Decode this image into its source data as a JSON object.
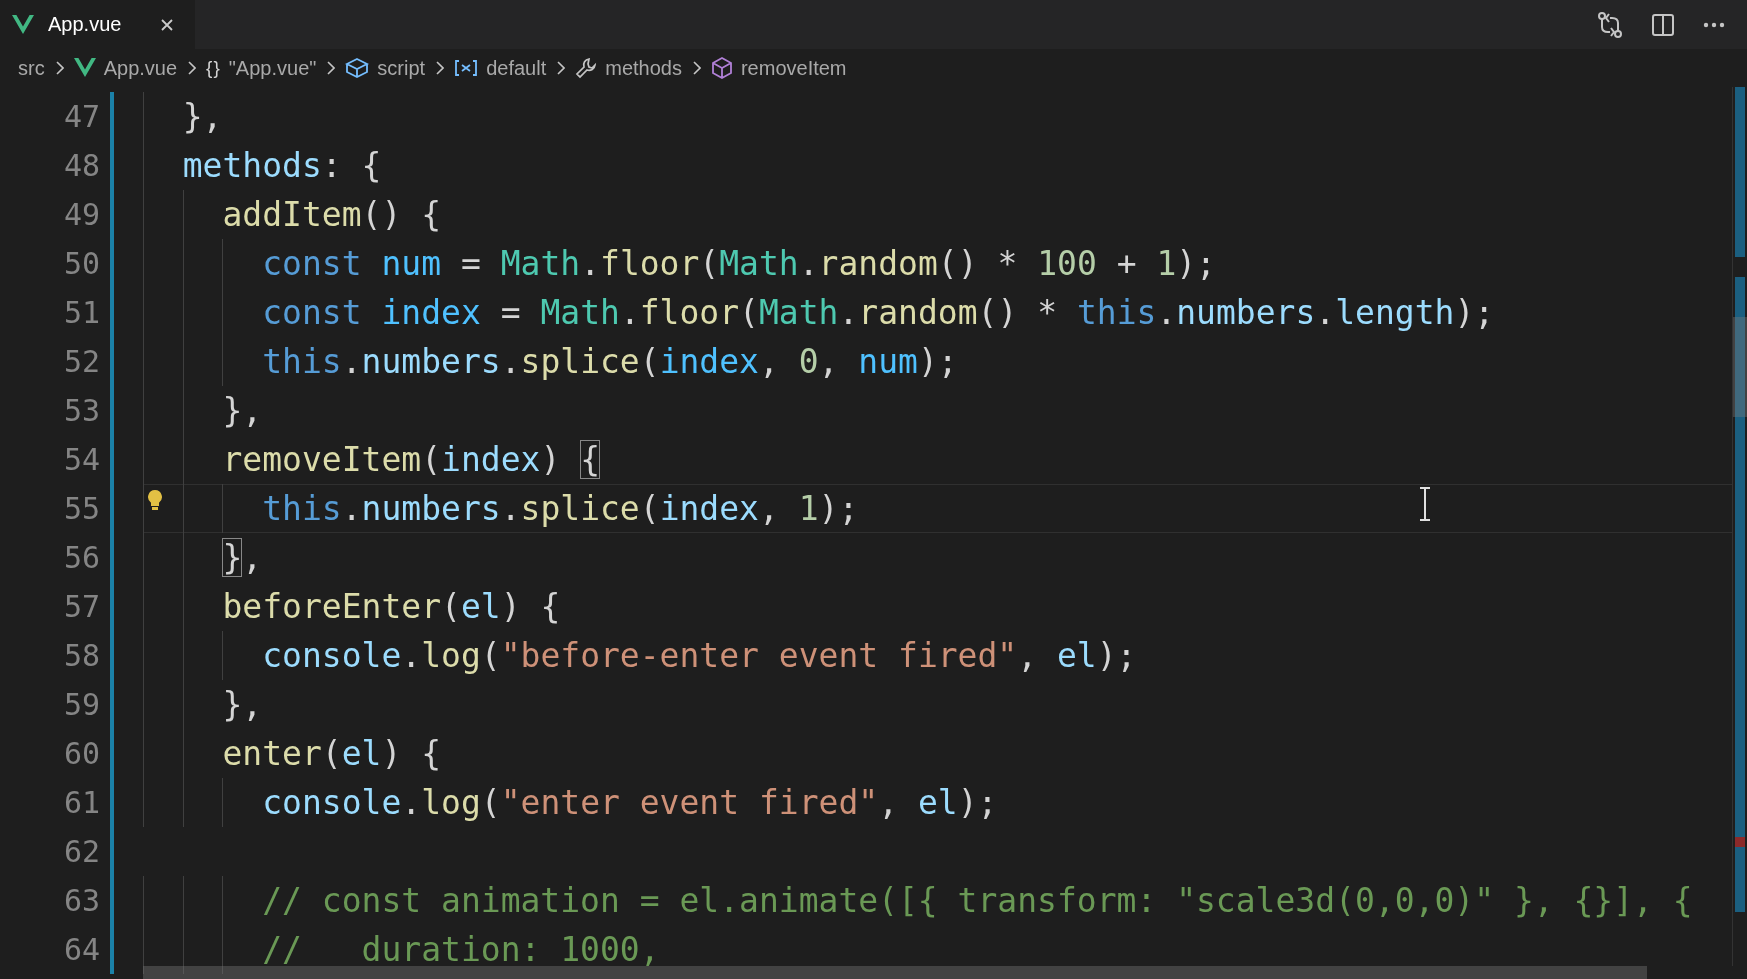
{
  "tabs": [
    {
      "label": "App.vue",
      "selected": true
    }
  ],
  "breadcrumbs": [
    {
      "kind": "folder",
      "label": "src"
    },
    {
      "kind": "vue",
      "label": "App.vue"
    },
    {
      "kind": "object",
      "glyph": "{}",
      "label": "\"App.vue\""
    },
    {
      "kind": "module",
      "label": "script"
    },
    {
      "kind": "variable",
      "label": "default"
    },
    {
      "kind": "property",
      "label": "methods"
    },
    {
      "kind": "method",
      "label": "removeItem"
    }
  ],
  "lines": [
    {
      "number": "47",
      "current": false,
      "lightbulb": false,
      "tokens": [
        {
          "kind": "punc",
          "text": "  },"
        }
      ]
    },
    {
      "number": "48",
      "current": false,
      "lightbulb": false,
      "tokens": [
        {
          "kind": "var",
          "text": "  methods"
        },
        {
          "kind": "punc",
          "text": ": {"
        }
      ]
    },
    {
      "number": "49",
      "current": false,
      "lightbulb": false,
      "tokens": [
        {
          "kind": "fn",
          "text": "    addItem"
        },
        {
          "kind": "punc",
          "text": "() {"
        }
      ]
    },
    {
      "number": "50",
      "current": false,
      "lightbulb": false,
      "tokens": [
        {
          "kind": "kw",
          "text": "      const"
        },
        {
          "kind": "cst",
          "text": " num"
        },
        {
          "kind": "punc",
          "text": " = "
        },
        {
          "kind": "cls",
          "text": "Math"
        },
        {
          "kind": "punc",
          "text": "."
        },
        {
          "kind": "fn",
          "text": "floor"
        },
        {
          "kind": "punc",
          "text": "("
        },
        {
          "kind": "cls",
          "text": "Math"
        },
        {
          "kind": "punc",
          "text": "."
        },
        {
          "kind": "fn",
          "text": "random"
        },
        {
          "kind": "punc",
          "text": "() * "
        },
        {
          "kind": "num",
          "text": "100"
        },
        {
          "kind": "punc",
          "text": " + "
        },
        {
          "kind": "num",
          "text": "1"
        },
        {
          "kind": "punc",
          "text": ");"
        }
      ]
    },
    {
      "number": "51",
      "current": false,
      "lightbulb": false,
      "tokens": [
        {
          "kind": "kw",
          "text": "      const"
        },
        {
          "kind": "cst",
          "text": " index"
        },
        {
          "kind": "punc",
          "text": " = "
        },
        {
          "kind": "cls",
          "text": "Math"
        },
        {
          "kind": "punc",
          "text": "."
        },
        {
          "kind": "fn",
          "text": "floor"
        },
        {
          "kind": "punc",
          "text": "("
        },
        {
          "kind": "cls",
          "text": "Math"
        },
        {
          "kind": "punc",
          "text": "."
        },
        {
          "kind": "fn",
          "text": "random"
        },
        {
          "kind": "punc",
          "text": "() * "
        },
        {
          "kind": "kw",
          "text": "this"
        },
        {
          "kind": "punc",
          "text": "."
        },
        {
          "kind": "var",
          "text": "numbers"
        },
        {
          "kind": "punc",
          "text": "."
        },
        {
          "kind": "var",
          "text": "length"
        },
        {
          "kind": "punc",
          "text": ");"
        }
      ]
    },
    {
      "number": "52",
      "current": false,
      "lightbulb": false,
      "tokens": [
        {
          "kind": "kw",
          "text": "      this"
        },
        {
          "kind": "punc",
          "text": "."
        },
        {
          "kind": "var",
          "text": "numbers"
        },
        {
          "kind": "punc",
          "text": "."
        },
        {
          "kind": "fn",
          "text": "splice"
        },
        {
          "kind": "punc",
          "text": "("
        },
        {
          "kind": "cst",
          "text": "index"
        },
        {
          "kind": "punc",
          "text": ", "
        },
        {
          "kind": "num",
          "text": "0"
        },
        {
          "kind": "punc",
          "text": ", "
        },
        {
          "kind": "cst",
          "text": "num"
        },
        {
          "kind": "punc",
          "text": ");"
        }
      ]
    },
    {
      "number": "53",
      "current": false,
      "lightbulb": false,
      "tokens": [
        {
          "kind": "punc",
          "text": "    },"
        }
      ]
    },
    {
      "number": "54",
      "current": false,
      "lightbulb": false,
      "tokens": [
        {
          "kind": "fn",
          "text": "    removeItem"
        },
        {
          "kind": "punc",
          "text": "("
        },
        {
          "kind": "var",
          "text": "index"
        },
        {
          "kind": "punc",
          "text": ") "
        },
        {
          "kind": "match",
          "text": "{"
        }
      ]
    },
    {
      "number": "55",
      "current": true,
      "lightbulb": true,
      "tokens": [
        {
          "kind": "kw",
          "text": "      this"
        },
        {
          "kind": "punc",
          "text": "."
        },
        {
          "kind": "var",
          "text": "numbers"
        },
        {
          "kind": "punc",
          "text": "."
        },
        {
          "kind": "fn",
          "text": "splice"
        },
        {
          "kind": "punc",
          "text": "("
        },
        {
          "kind": "var",
          "text": "index"
        },
        {
          "kind": "punc",
          "text": ", "
        },
        {
          "kind": "num",
          "text": "1"
        },
        {
          "kind": "punc",
          "text": ");"
        }
      ]
    },
    {
      "number": "56",
      "current": false,
      "lightbulb": false,
      "tokens": [
        {
          "kind": "match",
          "text": "    }"
        },
        {
          "kind": "punc",
          "text": ","
        }
      ]
    },
    {
      "number": "57",
      "current": false,
      "lightbulb": false,
      "tokens": [
        {
          "kind": "fn",
          "text": "    beforeEnter"
        },
        {
          "kind": "punc",
          "text": "("
        },
        {
          "kind": "var",
          "text": "el"
        },
        {
          "kind": "punc",
          "text": ") {"
        }
      ]
    },
    {
      "number": "58",
      "current": false,
      "lightbulb": false,
      "tokens": [
        {
          "kind": "var",
          "text": "      console"
        },
        {
          "kind": "punc",
          "text": "."
        },
        {
          "kind": "fn",
          "text": "log"
        },
        {
          "kind": "punc",
          "text": "("
        },
        {
          "kind": "str",
          "text": "\"before-enter event fired\""
        },
        {
          "kind": "punc",
          "text": ", "
        },
        {
          "kind": "var",
          "text": "el"
        },
        {
          "kind": "punc",
          "text": ");"
        }
      ]
    },
    {
      "number": "59",
      "current": false,
      "lightbulb": false,
      "tokens": [
        {
          "kind": "punc",
          "text": "    },"
        }
      ]
    },
    {
      "number": "60",
      "current": false,
      "lightbulb": false,
      "tokens": [
        {
          "kind": "fn",
          "text": "    enter"
        },
        {
          "kind": "punc",
          "text": "("
        },
        {
          "kind": "var",
          "text": "el"
        },
        {
          "kind": "punc",
          "text": ") {"
        }
      ]
    },
    {
      "number": "61",
      "current": false,
      "lightbulb": false,
      "tokens": [
        {
          "kind": "var",
          "text": "      console"
        },
        {
          "kind": "punc",
          "text": "."
        },
        {
          "kind": "fn",
          "text": "log"
        },
        {
          "kind": "punc",
          "text": "("
        },
        {
          "kind": "str",
          "text": "\"enter event fired\""
        },
        {
          "kind": "punc",
          "text": ", "
        },
        {
          "kind": "var",
          "text": "el"
        },
        {
          "kind": "punc",
          "text": ");"
        }
      ]
    },
    {
      "number": "62",
      "current": false,
      "lightbulb": false
    },
    {
      "number": "63",
      "current": false,
      "lightbulb": false,
      "tokens": [
        {
          "kind": "cmt",
          "text": "      // const animation = el.animate([{ transform: \"scale3d(0,0,0)\" }, {}], {"
        }
      ]
    },
    {
      "number": "64",
      "current": false,
      "lightbulb": false,
      "tokens": [
        {
          "kind": "cmt",
          "text": "      //   duration: 1000,"
        }
      ]
    }
  ]
}
